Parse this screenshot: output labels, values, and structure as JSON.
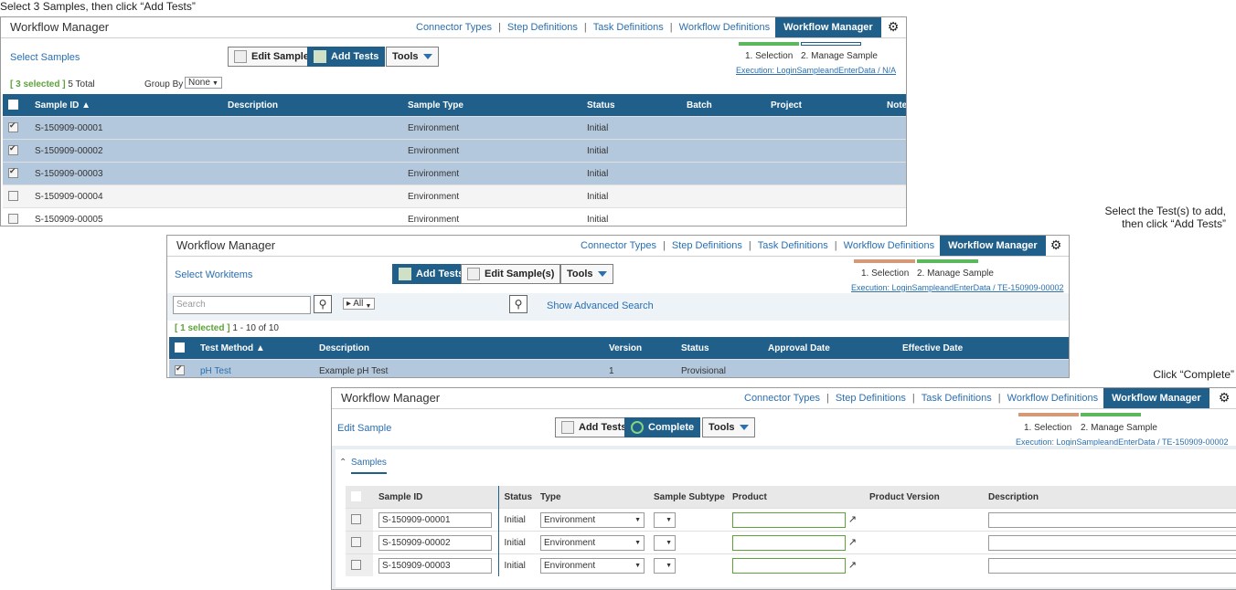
{
  "callouts": {
    "one": "Select 3 Samples, then click “Add Tests”",
    "two_line1": "Select the Test(s) to add,",
    "two_line2": "then click “Add Tests”",
    "three": "Click “Complete”"
  },
  "app_title": "Workflow Manager",
  "nav": {
    "connector_types": "Connector Types",
    "step_definitions": "Step Definitions",
    "task_definitions": "Task Definitions",
    "workflow_definitions": "Workflow Definitions",
    "workflow_manager": "Workflow Manager",
    "separator": "|"
  },
  "progress": {
    "step1": "1. Selection",
    "step2": "2. Manage Sample"
  },
  "panel1": {
    "subtitle": "Select Samples",
    "edit_sample": "Edit Sample",
    "add_tests": "Add Tests",
    "tools": "Tools",
    "execution": "Execution: LoginSampleandEnterData / N/A",
    "selected": "[ 3 selected ]",
    "total": "5 Total",
    "group_by_label": "Group By",
    "group_by_value": "None",
    "columns": [
      "Sample ID ▲",
      "Description",
      "Sample Type",
      "Status",
      "Batch",
      "Project",
      "Note"
    ],
    "rows": [
      {
        "checked": true,
        "id": "S-150909-00001",
        "description": "",
        "type": "Environment",
        "status": "Initial"
      },
      {
        "checked": true,
        "id": "S-150909-00002",
        "description": "",
        "type": "Environment",
        "status": "Initial"
      },
      {
        "checked": true,
        "id": "S-150909-00003",
        "description": "",
        "type": "Environment",
        "status": "Initial"
      },
      {
        "checked": false,
        "id": "S-150909-00004",
        "description": "",
        "type": "Environment",
        "status": "Initial"
      },
      {
        "checked": false,
        "id": "S-150909-00005",
        "description": "",
        "type": "Environment",
        "status": "Initial"
      }
    ]
  },
  "panel2": {
    "subtitle": "Select Workitems",
    "add_tests": "Add Tests",
    "edit_samples": "Edit Sample(s)",
    "tools": "Tools",
    "execution": "Execution: LoginSampleandEnterData / TE-150909-00002",
    "search_placeholder": "Search",
    "filter_value": "All",
    "advanced": "Show Advanced Search",
    "selected": "[ 1 selected ]",
    "range": "1 - 10 of 10",
    "columns": [
      "Test Method ▲",
      "Description",
      "Version",
      "Status",
      "Approval Date",
      "Effective Date"
    ],
    "rows": [
      {
        "checked": true,
        "method": "pH Test",
        "description": "Example pH Test",
        "version": "1",
        "status": "Provisional",
        "approval": "",
        "effective": ""
      }
    ]
  },
  "panel3": {
    "subtitle": "Edit Sample",
    "add_tests": "Add Tests",
    "complete": "Complete",
    "tools": "Tools",
    "execution": "Execution: LoginSampleandEnterData / TE-150909-00002",
    "section": "Samples",
    "columns": [
      "Sample ID",
      "Status",
      "Type",
      "Sample Subtype",
      "Product",
      "Product Version",
      "Description"
    ],
    "rows": [
      {
        "id": "S-150909-00001",
        "status": "Initial",
        "type": "Environment"
      },
      {
        "id": "S-150909-00002",
        "status": "Initial",
        "type": "Environment"
      },
      {
        "id": "S-150909-00003",
        "status": "Initial",
        "type": "Environment"
      }
    ]
  }
}
